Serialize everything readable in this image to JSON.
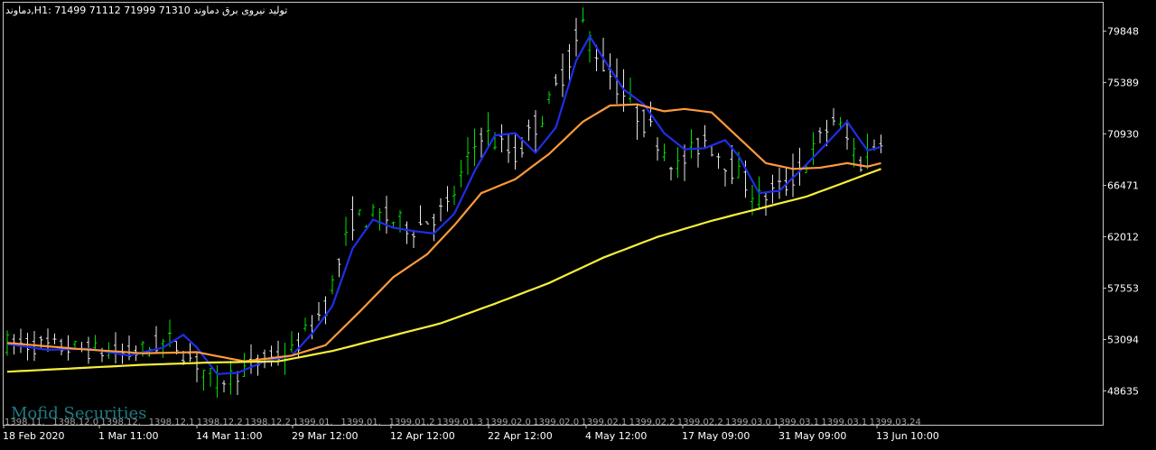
{
  "header": {
    "symbol": "دماوند",
    "timeframe": "H1",
    "ohlc": "71499 71112 71999 71310",
    "description": "تولید نیروی برق دماوند"
  },
  "watermark": "Mofid Securities",
  "colors": {
    "background": "#000000",
    "frame": "#c8c8c8",
    "text": "#ffffff",
    "bar_up": "#00e000",
    "bar_down": "#e8e8e8",
    "ma_fast": "#1f2ee8",
    "ma_mid": "#ff9a3c",
    "ma_slow": "#f6f03a",
    "watermark": "#1f7a84"
  },
  "chart_data": {
    "type": "line",
    "title": "",
    "grid": false,
    "ylim": [
      45700,
      82320
    ],
    "y_ticks": [
      "79848",
      "75389",
      "70930",
      "66471",
      "62012",
      "57553",
      "53094",
      "48635"
    ],
    "x_ticks": [
      "18 Feb 2020",
      "1 Mar 11:00",
      "14 Mar 11:00",
      "29 Mar 12:00",
      "12 Apr 12:00",
      "22 Apr 12:00",
      "4 May 12:00",
      "17 May 09:00",
      "31 May 09:00",
      "13 Jun 10:00"
    ],
    "x_ticks_secondary": [
      "1398.11.",
      "1398.12.0",
      "1398.12.",
      "1398.12.1",
      "1398.12.2",
      "1398.12.2",
      "1399.01.",
      "1399.01.",
      "1399.01.2",
      "1399.01.3",
      "1399.02.0",
      "1399.02.0",
      "1399.02.1",
      "1399.02.2",
      "1399.02.2",
      "1399.03.0",
      "1399.03.1",
      "1399.03.1",
      "1399.03.24"
    ],
    "n_bars": 130,
    "ohlc_keypoints": [
      [
        0,
        52800
      ],
      [
        10,
        52300
      ],
      [
        18,
        51800
      ],
      [
        24,
        53000
      ],
      [
        27,
        51500
      ],
      [
        31,
        49400
      ],
      [
        38,
        51300
      ],
      [
        42,
        52000
      ],
      [
        47,
        56000
      ],
      [
        51,
        63500
      ],
      [
        55,
        63800
      ],
      [
        60,
        62800
      ],
      [
        65,
        64500
      ],
      [
        70,
        71200
      ],
      [
        75,
        69000
      ],
      [
        80,
        73500
      ],
      [
        85,
        80300
      ],
      [
        88,
        77000
      ],
      [
        92,
        73500
      ],
      [
        96,
        70500
      ],
      [
        99,
        68000
      ],
      [
        103,
        70500
      ],
      [
        107,
        68000
      ],
      [
        111,
        65300
      ],
      [
        115,
        66500
      ],
      [
        118,
        68500
      ],
      [
        122,
        72300
      ],
      [
        126,
        68500
      ],
      [
        129,
        70800
      ]
    ],
    "series": [
      {
        "key": "ma_fast",
        "points": [
          [
            0,
            52700
          ],
          [
            6,
            52200
          ],
          [
            12,
            52300
          ],
          [
            18,
            51700
          ],
          [
            23,
            52400
          ],
          [
            26,
            53500
          ],
          [
            28,
            52400
          ],
          [
            31,
            50100
          ],
          [
            34,
            50200
          ],
          [
            38,
            51200
          ],
          [
            42,
            51700
          ],
          [
            45,
            53600
          ],
          [
            48,
            56000
          ],
          [
            51,
            61000
          ],
          [
            54,
            63500
          ],
          [
            57,
            62800
          ],
          [
            60,
            62500
          ],
          [
            63,
            62300
          ],
          [
            66,
            64000
          ],
          [
            69,
            67700
          ],
          [
            72,
            70800
          ],
          [
            75,
            71000
          ],
          [
            78,
            69300
          ],
          [
            81,
            71500
          ],
          [
            84,
            77300
          ],
          [
            86,
            79400
          ],
          [
            88,
            77500
          ],
          [
            91,
            74800
          ],
          [
            94,
            73500
          ],
          [
            97,
            71000
          ],
          [
            100,
            69600
          ],
          [
            103,
            69700
          ],
          [
            106,
            70400
          ],
          [
            108,
            69000
          ],
          [
            111,
            65800
          ],
          [
            114,
            66000
          ],
          [
            117,
            67700
          ],
          [
            120,
            69500
          ],
          [
            124,
            72000
          ],
          [
            127,
            69500
          ],
          [
            129,
            69800
          ]
        ]
      },
      {
        "key": "ma_mid",
        "points": [
          [
            0,
            52800
          ],
          [
            10,
            52300
          ],
          [
            20,
            51900
          ],
          [
            28,
            52000
          ],
          [
            35,
            51200
          ],
          [
            42,
            51700
          ],
          [
            47,
            52600
          ],
          [
            52,
            55500
          ],
          [
            57,
            58500
          ],
          [
            62,
            60500
          ],
          [
            66,
            63000
          ],
          [
            70,
            65800
          ],
          [
            75,
            67000
          ],
          [
            80,
            69200
          ],
          [
            85,
            72000
          ],
          [
            89,
            73400
          ],
          [
            93,
            73500
          ],
          [
            97,
            72900
          ],
          [
            100,
            73100
          ],
          [
            104,
            72800
          ],
          [
            108,
            70600
          ],
          [
            112,
            68400
          ],
          [
            116,
            67900
          ],
          [
            120,
            68000
          ],
          [
            124,
            68400
          ],
          [
            127,
            68100
          ],
          [
            129,
            68400
          ]
        ]
      },
      {
        "key": "ma_slow",
        "points": [
          [
            0,
            50300
          ],
          [
            10,
            50600
          ],
          [
            20,
            50900
          ],
          [
            30,
            51100
          ],
          [
            40,
            51200
          ],
          [
            48,
            52100
          ],
          [
            56,
            53300
          ],
          [
            64,
            54500
          ],
          [
            72,
            56200
          ],
          [
            80,
            58000
          ],
          [
            88,
            60200
          ],
          [
            96,
            62000
          ],
          [
            104,
            63400
          ],
          [
            112,
            64600
          ],
          [
            118,
            65500
          ],
          [
            124,
            66800
          ],
          [
            129,
            67900
          ]
        ]
      }
    ]
  }
}
